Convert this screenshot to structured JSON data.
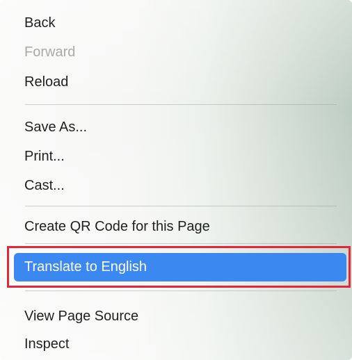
{
  "menu": {
    "items": {
      "back": "Back",
      "forward": "Forward",
      "reload": "Reload",
      "save_as": "Save As...",
      "print": "Print...",
      "cast": "Cast...",
      "qr_code": "Create QR Code for this Page",
      "translate": "Translate to English",
      "view_source": "View Page Source",
      "inspect": "Inspect"
    },
    "disabled": [
      "forward"
    ],
    "highlighted": "translate",
    "colors": {
      "highlight": "#3b88f0",
      "annotation_frame": "#e0283a",
      "disabled_text": "#a9aaa8"
    }
  }
}
